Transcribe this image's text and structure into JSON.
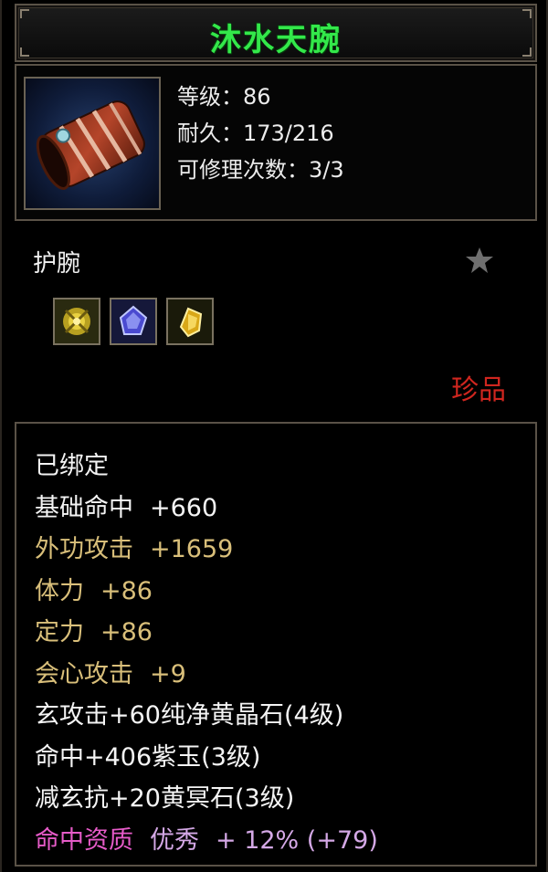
{
  "item": {
    "name": "沐水天腕",
    "level_line": "等级：86",
    "durability_line": "耐久：173/216",
    "repair_line": "可修理次数：3/3",
    "type": "护腕",
    "rarity": "珍品"
  },
  "icons": {
    "item_icon": "bracer-icon",
    "favorite": "star-icon",
    "gems": [
      "yellow-gem-icon",
      "purple-gem-icon",
      "gold-gem-icon"
    ]
  },
  "attributes": {
    "bound": "已绑定",
    "base_hit_label": "基础命中",
    "base_hit_value": "+660",
    "ext_attack_label": "外功攻击",
    "ext_attack_value": "+1659",
    "stamina_label": "体力",
    "stamina_value": "+86",
    "focus_label": "定力",
    "focus_value": "+86",
    "crit_label": "会心攻击",
    "crit_value": "+9",
    "gem_line_1": "玄攻击+60纯净黄晶石(4级)",
    "gem_line_2": "命中+406紫玉(3级)",
    "gem_line_3": "减玄抗+20黄冥石(3级)",
    "aptitude_label": "命中资质",
    "aptitude_grade": "优秀",
    "aptitude_bonus": "+ 12% (+79)"
  },
  "colors": {
    "name_green": "#33e84a",
    "rarity_red": "#d0261f",
    "gold_text": "#d9bf7a",
    "aptitude_pink": "#e65bc8"
  }
}
